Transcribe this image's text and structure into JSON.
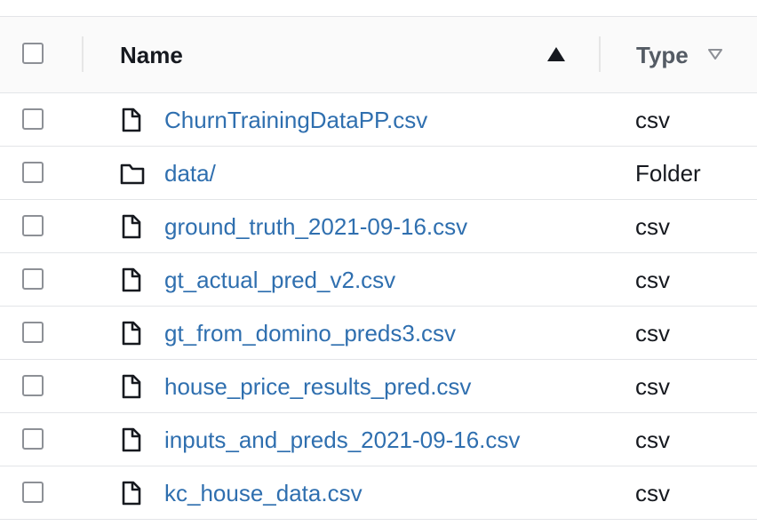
{
  "header": {
    "name_label": "Name",
    "type_label": "Type"
  },
  "rows": [
    {
      "name": "ChurnTrainingDataPP.csv",
      "type": "csv",
      "icon": "file-icon"
    },
    {
      "name": "data/",
      "type": "Folder",
      "icon": "folder-icon"
    },
    {
      "name": "ground_truth_2021-09-16.csv",
      "type": "csv",
      "icon": "file-icon"
    },
    {
      "name": "gt_actual_pred_v2.csv",
      "type": "csv",
      "icon": "file-icon"
    },
    {
      "name": "gt_from_domino_preds3.csv",
      "type": "csv",
      "icon": "file-icon"
    },
    {
      "name": "house_price_results_pred.csv",
      "type": "csv",
      "icon": "file-icon"
    },
    {
      "name": "inputs_and_preds_2021-09-16.csv",
      "type": "csv",
      "icon": "file-icon"
    },
    {
      "name": "kc_house_data.csv",
      "type": "csv",
      "icon": "file-icon"
    }
  ],
  "colors": {
    "link": "#2f6faf",
    "text": "#16191f",
    "header_bg": "#fafafa",
    "divider": "#e3e5e8"
  }
}
